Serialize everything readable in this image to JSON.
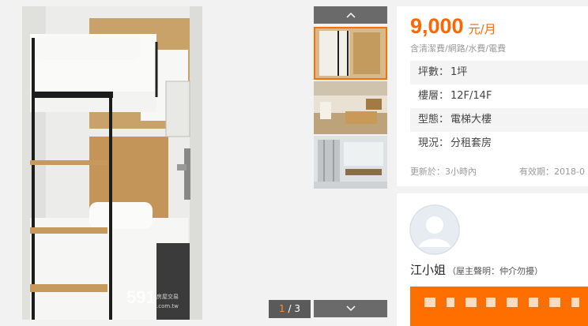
{
  "gallery": {
    "counter_current": "1",
    "counter_total": "3",
    "watermark_number": "591",
    "watermark_cn": "房屋交易",
    "watermark_domain": ".com.tw",
    "prev_icon": "chevron-up-icon",
    "next_icon": "chevron-down-icon"
  },
  "listing": {
    "price": "9,000",
    "price_unit": "元/月",
    "price_includes": "含清潔費/網路/水費/電費",
    "attributes": [
      {
        "label": "坪數：",
        "value": "1坪"
      },
      {
        "label": "樓層：",
        "value": "12F/14F"
      },
      {
        "label": "型態：",
        "value": "電梯大樓"
      },
      {
        "label": "現況：",
        "value": "分租套房"
      }
    ],
    "updated": "更新於：3小時內",
    "expires": "有效期：2018-0"
  },
  "contact": {
    "name": "江小姐",
    "note": "（屋主聲明：仲介勿擾）"
  },
  "colors": {
    "accent": "#ff6600",
    "call_bar": "#ff6f00",
    "thumb_border": "#ff6e00"
  }
}
